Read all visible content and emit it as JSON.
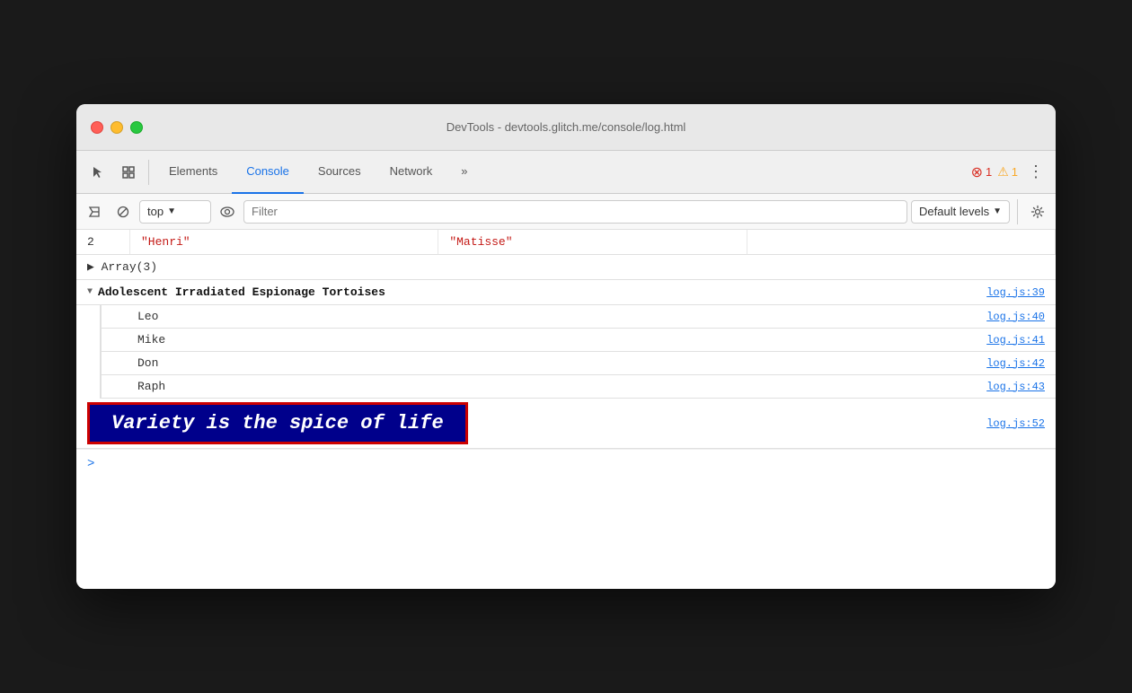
{
  "window": {
    "title": "DevTools - devtools.glitch.me/console/log.html"
  },
  "toolbar": {
    "tabs": [
      {
        "id": "elements",
        "label": "Elements",
        "active": false
      },
      {
        "id": "console",
        "label": "Console",
        "active": true
      },
      {
        "id": "sources",
        "label": "Sources",
        "active": false
      },
      {
        "id": "network",
        "label": "Network",
        "active": false
      }
    ],
    "more_label": "»",
    "error_count": "1",
    "warn_count": "1"
  },
  "console_toolbar": {
    "context": "top",
    "filter_placeholder": "Filter",
    "levels_label": "Default levels"
  },
  "console": {
    "table": {
      "row": {
        "index": "2",
        "col1": "\"Henri\"",
        "col2": "\"Matisse\""
      }
    },
    "array_label": "▶ Array(3)",
    "group": {
      "triangle": "▼",
      "label": "Adolescent Irradiated Espionage Tortoises",
      "link": "log.js:39",
      "items": [
        {
          "text": "Leo",
          "link": "log.js:40"
        },
        {
          "text": "Mike",
          "link": "log.js:41"
        },
        {
          "text": "Don",
          "link": "log.js:42"
        },
        {
          "text": "Raph",
          "link": "log.js:43"
        }
      ]
    },
    "styled_output": {
      "text": "Variety is the spice of life",
      "link": "log.js:52"
    },
    "prompt_arrow": ">"
  }
}
